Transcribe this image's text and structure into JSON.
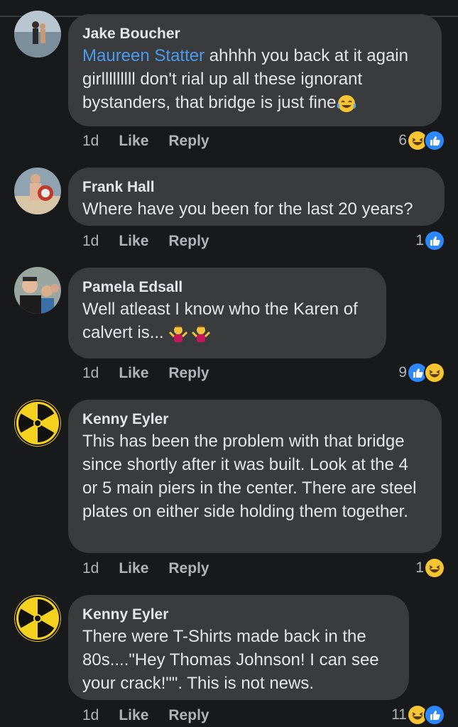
{
  "comments": [
    {
      "author": "Jake Boucher",
      "mention": "Maureen Statter",
      "text": " ahhhh you back at it again girlllllllll don't rial up all these ignorant bystanders, that bridge is just fine",
      "emoji": "laughing-tears-emoji",
      "time": "1d",
      "like": "Like",
      "reply": "Reply",
      "reaction_count": "6",
      "reactions": [
        "haha-icon",
        "like-icon"
      ]
    },
    {
      "author": "Frank Hall",
      "text": "Where have you been for the last 20 years?",
      "time": "1d",
      "like": "Like",
      "reply": "Reply",
      "reaction_count": "1",
      "reactions": [
        "like-icon"
      ]
    },
    {
      "author": "Pamela Edsall",
      "text": "Well atleast I know who the Karen of calvert is... ",
      "emoji": "shrug-emoji",
      "time": "1d",
      "like": "Like",
      "reply": "Reply",
      "reaction_count": "9",
      "reactions": [
        "like-icon",
        "haha-icon"
      ]
    },
    {
      "author": "Kenny Eyler",
      "text": "This has been the problem with that bridge since shortly after it was built. Look at the 4 or 5 main piers in the center. There are steel plates on either side holding them together.",
      "time": "1d",
      "like": "Like",
      "reply": "Reply",
      "reaction_count": "1",
      "reactions": [
        "haha-icon"
      ]
    },
    {
      "author": "Kenny Eyler",
      "text": "There were T-Shirts made back in the 80s....\"Hey Thomas Johnson! I can see your crack!\"\". This is not news.",
      "time": "1d",
      "like": "Like",
      "reply": "Reply",
      "reaction_count": "11",
      "reactions": [
        "haha-icon",
        "like-icon"
      ]
    }
  ],
  "colors": {
    "background": "#18191a",
    "bubble": "#3a3b3c",
    "text": "#e4e6eb",
    "secondary": "#b0b3b8",
    "mention": "#4a9cf0",
    "like_blue": "#2d88ff",
    "haha_yellow": "#f7c531",
    "radiation_yellow": "#f4d21f"
  }
}
